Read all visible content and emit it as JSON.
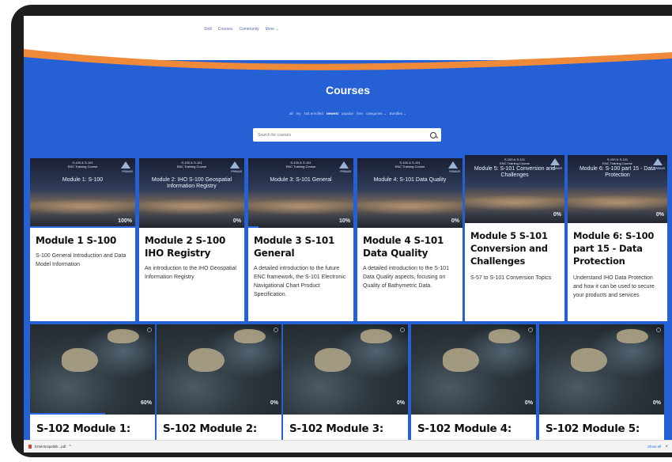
{
  "nav": {
    "items": [
      "Stoll",
      "Courses",
      "Community",
      "More ⌄"
    ]
  },
  "hero": {
    "title": "Courses",
    "filters": [
      "all",
      "my",
      "Not enrolled",
      "newest",
      "popular",
      "free",
      "categories ⌄",
      "Bundles ⌄"
    ],
    "active_filter": "newest",
    "search_placeholder": "Search for courses"
  },
  "thumb_header": {
    "line1": "S-100 & S-101",
    "line2": "ENC Training Course",
    "logo": "PRIMAR"
  },
  "modules": [
    {
      "thumb_title": "Module 1: S-100",
      "progress": "100%",
      "title": "Module 1 S-100",
      "description": "S-100 General Introduction and Data Model Information"
    },
    {
      "thumb_title": "Module 2: IHO S-100 Geospatial Information Registry",
      "progress": "0%",
      "title": "Module 2 S-100 IHO Registry",
      "description": "An introduction to the IHO Geospatial Information Registry"
    },
    {
      "thumb_title": "Module 3: S-101 General",
      "progress": "10%",
      "title": "Module 3 S-101 General",
      "description": "A detailed introduction to the future ENC framework, the S-101 Electronic Navigational Chart Product Specification."
    },
    {
      "thumb_title": "Module 4: S-101 Data Quality",
      "progress": "0%",
      "title": "Module 4 S-101 Data Quality",
      "description": "A detailed introduction to the S-101 Data Quality aspects, focusing on Quality of Bathymetric Data."
    },
    {
      "thumb_title": "Module 5: S-101 Conversion and Challenges",
      "progress": "0%",
      "title": "Module 5 S-101 Conversion and Challenges",
      "description": "S-57 to S-101 Conversion Topics"
    },
    {
      "thumb_title": "Module 6: S-100 part 15 - Data Protection",
      "progress": "0%",
      "title": "Module 6: S-100 part 15 - Data Protection",
      "description": "Understand IHO Data Protection and how it can be used to secure your products and services"
    }
  ],
  "s102": [
    {
      "title": "S-102 Module 1:",
      "progress": "60%"
    },
    {
      "title": "S-102 Module 2:",
      "progress": "0%"
    },
    {
      "title": "S-102 Module 3:",
      "progress": "0%"
    },
    {
      "title": "S-102 Module 4:",
      "progress": "0%"
    },
    {
      "title": "S-102 Module 5:",
      "progress": "0%"
    }
  ],
  "download_bar": {
    "file": "Entertinspetitik...pdf",
    "chevron": "^",
    "show_all": "Show all",
    "close": "×"
  },
  "colors": {
    "accent": "#2560d5",
    "wave_orange": "#ee8a3a",
    "progress": "#2f6ae0"
  }
}
